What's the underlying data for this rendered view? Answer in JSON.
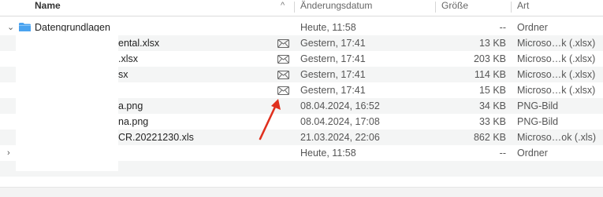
{
  "columns": {
    "name": "Name",
    "sort_indicator": "^",
    "date": "Änderungsdatum",
    "size": "Größe",
    "kind": "Art"
  },
  "folder": {
    "name": "Datengrundlagen",
    "date": "Heute, 11:58",
    "size": "--",
    "kind": "Ordner"
  },
  "files": [
    {
      "name": "ental.xlsx",
      "date": "Gestern, 17:41",
      "size": "13 KB",
      "kind": "Microso…k (.xlsx)",
      "mail_icon": "envelope-icon"
    },
    {
      "name": ".xlsx",
      "date": "Gestern, 17:41",
      "size": "203 KB",
      "kind": "Microso…k (.xlsx)",
      "mail_icon": "envelope-icon"
    },
    {
      "name": "sx",
      "date": "Gestern, 17:41",
      "size": "114 KB",
      "kind": "Microso…k (.xlsx)",
      "mail_icon": "envelope-icon"
    },
    {
      "name": "",
      "date": "Gestern, 17:41",
      "size": "15 KB",
      "kind": "Microso…k (.xlsx)",
      "mail_icon": "envelope-icon"
    },
    {
      "name": "a.png",
      "date": "08.04.2024, 16:52",
      "size": "34 KB",
      "kind": "PNG-Bild"
    },
    {
      "name": "na.png",
      "date": "08.04.2024, 17:08",
      "size": "33 KB",
      "kind": "PNG-Bild"
    },
    {
      "name": "CR.20221230.xls",
      "date": "21.03.2024, 22:06",
      "size": "862 KB",
      "kind": "Microso…ok (.xls)"
    }
  ],
  "collapsed_folder": {
    "date": "Heute, 11:58",
    "size": "--",
    "kind": "Ordner"
  },
  "colors": {
    "folder_blue": "#4aa3f0",
    "arrow_red": "#e0301e",
    "stripe": "#f4f5f5"
  }
}
